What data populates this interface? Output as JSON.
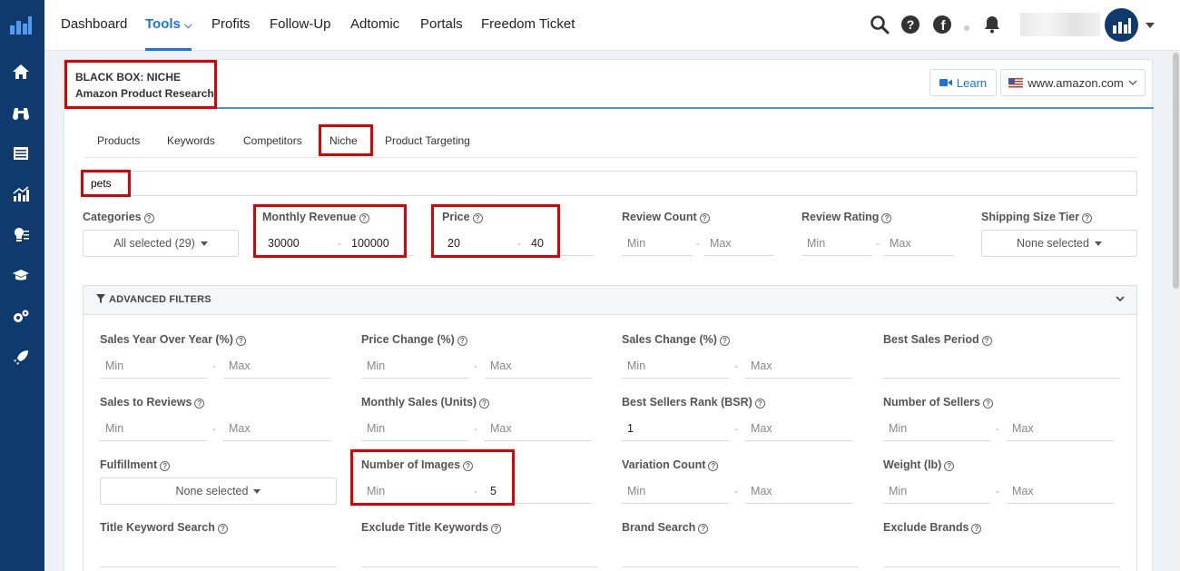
{
  "nav": {
    "items": [
      "Dashboard",
      "Tools",
      "Profits",
      "Follow-Up",
      "Adtomic",
      "Portals",
      "Freedom Ticket"
    ],
    "active": "Tools",
    "accent": "#1a73e8",
    "sidebar_color": "#0e3a6e"
  },
  "header": {
    "title": "BLACK BOX: NICHE",
    "subtitle": "Amazon Product Research",
    "learn_label": "Learn",
    "marketplace": "www.amazon.com"
  },
  "tabs": [
    "Products",
    "Keywords",
    "Competitors",
    "Niche",
    "Product Targeting"
  ],
  "search": {
    "value": "pets"
  },
  "filters": {
    "categories": {
      "label": "Categories",
      "value": "All selected (29)"
    },
    "monthly_revenue": {
      "label": "Monthly Revenue",
      "min": "30000",
      "max": "100000"
    },
    "price": {
      "label": "Price",
      "min": "20",
      "max": "40"
    },
    "review_count": {
      "label": "Review Count",
      "min": "Min",
      "max": "Max"
    },
    "review_rating": {
      "label": "Review Rating",
      "min": "Min",
      "max": "Max"
    },
    "shipping_size": {
      "label": "Shipping Size Tier",
      "value": "None selected"
    }
  },
  "advanced": {
    "title": "ADVANCED FILTERS",
    "sales_yoy": {
      "label": "Sales Year Over Year (%)",
      "min": "Min",
      "max": "Max"
    },
    "price_change": {
      "label": "Price Change (%)",
      "min": "Min",
      "max": "Max"
    },
    "sales_change": {
      "label": "Sales Change (%)",
      "min": "Min",
      "max": "Max"
    },
    "best_sales_period": {
      "label": "Best Sales Period"
    },
    "sales_to_reviews": {
      "label": "Sales to Reviews",
      "min": "Min",
      "max": "Max"
    },
    "monthly_sales": {
      "label": "Monthly Sales (Units)",
      "min": "Min",
      "max": "Max"
    },
    "bsr": {
      "label": "Best Sellers Rank (BSR)",
      "min": "1",
      "max": "Max"
    },
    "num_sellers": {
      "label": "Number of Sellers",
      "min": "Min",
      "max": "Max"
    },
    "fulfillment": {
      "label": "Fulfillment",
      "value": "None selected"
    },
    "num_images": {
      "label": "Number of Images",
      "min": "Min",
      "max": "5"
    },
    "variation_count": {
      "label": "Variation Count",
      "min": "Min",
      "max": "Max"
    },
    "weight": {
      "label": "Weight (lb)",
      "min": "Min",
      "max": "Max"
    },
    "title_keyword": {
      "label": "Title Keyword Search"
    },
    "exclude_title": {
      "label": "Exclude Title Keywords"
    },
    "brand_search": {
      "label": "Brand Search"
    },
    "exclude_brands": {
      "label": "Exclude Brands"
    }
  },
  "highlight_color": "#e00000"
}
